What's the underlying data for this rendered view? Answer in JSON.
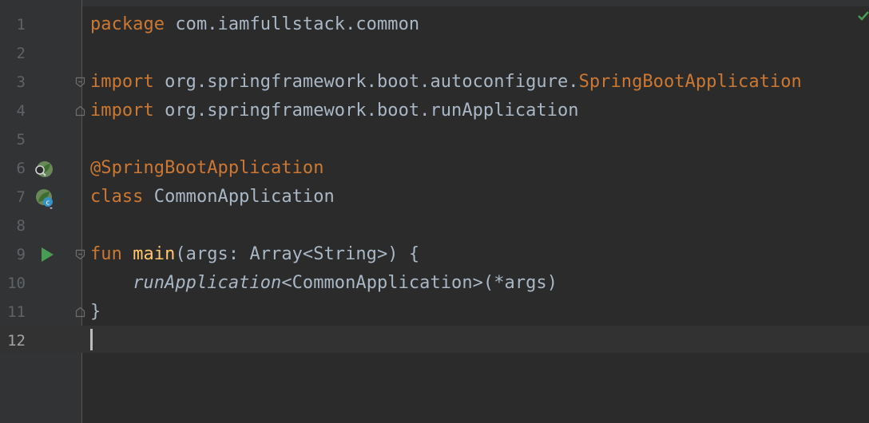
{
  "lines": [
    {
      "number": "1",
      "tokens": [
        "package",
        " com.iamfullstack.common"
      ]
    },
    {
      "number": "2",
      "tokens": []
    },
    {
      "number": "3",
      "tokens": [
        "import",
        " org.springframework.boot.autoconfigure.",
        "SpringBootApplication"
      ]
    },
    {
      "number": "4",
      "tokens": [
        "import",
        " org.springframework.boot.runApplication"
      ]
    },
    {
      "number": "5",
      "tokens": []
    },
    {
      "number": "6",
      "tokens": [
        "@SpringBootApplication"
      ]
    },
    {
      "number": "7",
      "tokens": [
        "class",
        " CommonApplication"
      ]
    },
    {
      "number": "8",
      "tokens": []
    },
    {
      "number": "9",
      "tokens": [
        "fun",
        " ",
        "main",
        "(args: Array<String>) {"
      ]
    },
    {
      "number": "10",
      "tokens": [
        "    ",
        "runApplication",
        "<CommonApplication>(*args)"
      ]
    },
    {
      "number": "11",
      "tokens": [
        "}"
      ]
    },
    {
      "number": "12",
      "tokens": []
    }
  ],
  "current_line": "12",
  "gutter_icons": {
    "line6": "spring-bean-search-icon",
    "line7": "spring-bean-class-icon",
    "line9": "run-icon"
  },
  "colors": {
    "background": "#2b2b2b",
    "gutter": "#313335",
    "keyword": "#cc7832",
    "text": "#a9b7c6",
    "function": "#ffc66d",
    "annotation": "#bbb529",
    "line_number": "#606366"
  }
}
